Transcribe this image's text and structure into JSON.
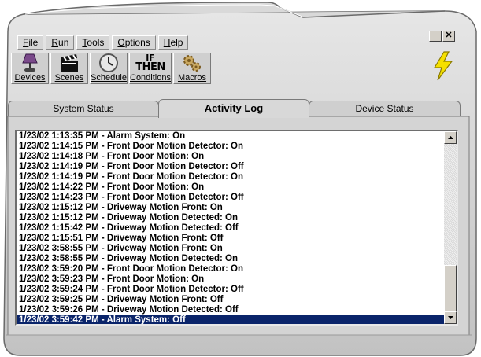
{
  "menu": [
    {
      "key": "F",
      "rest": "ile"
    },
    {
      "key": "R",
      "rest": "un"
    },
    {
      "key": "T",
      "rest": "ools"
    },
    {
      "key": "O",
      "rest": "ptions"
    },
    {
      "key": "H",
      "rest": "elp"
    }
  ],
  "window_buttons": {
    "minimize": "_",
    "close": "✕"
  },
  "toolbar": {
    "devices": "Devices",
    "scenes": "Scenes",
    "schedule": "Schedule",
    "conditions": "Conditions",
    "macros": "Macros",
    "if_then_top": "IF",
    "if_then_bottom": "THEN"
  },
  "tabs": {
    "system_status": "System Status",
    "activity_log": "Activity Log",
    "device_status": "Device Status",
    "active": "activity_log"
  },
  "log": {
    "entries": [
      "1/23/02 1:13:35 PM - Alarm System: On",
      "1/23/02 1:14:15 PM - Front Door Motion Detector: On",
      "1/23/02 1:14:18 PM - Front Door Motion: On",
      "1/23/02 1:14:19 PM - Front Door Motion Detector: Off",
      "1/23/02 1:14:19 PM - Front Door Motion Detector: On",
      "1/23/02 1:14:22 PM - Front Door Motion: On",
      "1/23/02 1:14:23 PM - Front Door Motion Detector: Off",
      "1/23/02 1:15:12 PM - Driveway Motion Front: On",
      "1/23/02 1:15:12 PM - Driveway Motion Detected: On",
      "1/23/02 1:15:42 PM - Driveway Motion Detected: Off",
      "1/23/02 1:15:51 PM - Driveway Motion Front: Off",
      "1/23/02 3:58:55 PM - Driveway Motion Front: On",
      "1/23/02 3:58:55 PM - Driveway Motion Detected: On",
      "1/23/02 3:59:20 PM - Front Door Motion Detector: On",
      "1/23/02 3:59:23 PM - Front Door Motion: On",
      "1/23/02 3:59:24 PM - Front Door Motion Detector: Off",
      "1/23/02 3:59:25 PM - Driveway Motion Front: Off",
      "1/23/02 3:59:26 PM - Driveway Motion Detected: Off",
      "1/23/02 3:59:42 PM - Alarm System: Off"
    ],
    "selected_index": 18
  },
  "colors": {
    "selection": "#0a246a",
    "bolt": "#f5e000",
    "chrome": "#cfcfcf"
  },
  "icons": {
    "devices": "lamp-icon",
    "scenes": "clapperboard-icon",
    "schedule": "clock-icon",
    "conditions": "if-then-icon",
    "macros": "gears-icon",
    "bolt": "lightning-icon"
  }
}
